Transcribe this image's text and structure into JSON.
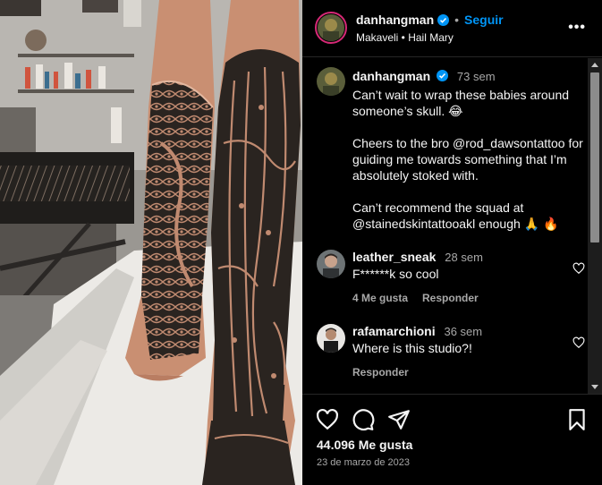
{
  "post": {
    "username": "danhangman",
    "follow_label": "Seguir",
    "separator": "•",
    "audio": "Makaveli • Hail Mary",
    "more_label": "•••"
  },
  "caption": {
    "username": "danhangman",
    "time": "73 sem",
    "text": "Can’t wait to wrap these babies around someone’s skull. 😂\n\nCheers to the bro @rod_dawsontattoo for guiding me towards something that I’m absolutely stoked with.\n\nCan’t recommend the squad at @stainedskintattooakl enough 🙏 🔥"
  },
  "comments": [
    {
      "username": "leather_sneak",
      "time": "28 sem",
      "text": "F******k so cool",
      "likes_label": "4 Me gusta",
      "reply_label": "Responder"
    },
    {
      "username": "rafamarchioni",
      "time": "36 sem",
      "text": "Where is this studio?!",
      "reply_label": "Responder"
    }
  ],
  "footer": {
    "likes": "44.096 Me gusta",
    "date": "23 de marzo de 2023"
  },
  "colors": {
    "accent": "#0095f6",
    "background": "#000000",
    "muted_text": "#a8a8a8",
    "divider": "#262626",
    "skin": "#c98f72",
    "ink": "#1c1c1c"
  },
  "icons": [
    "verified-badge-icon",
    "more-options-icon",
    "heart-icon",
    "comment-icon",
    "share-icon",
    "bookmark-icon",
    "scroll-up-icon",
    "scroll-down-icon"
  ]
}
